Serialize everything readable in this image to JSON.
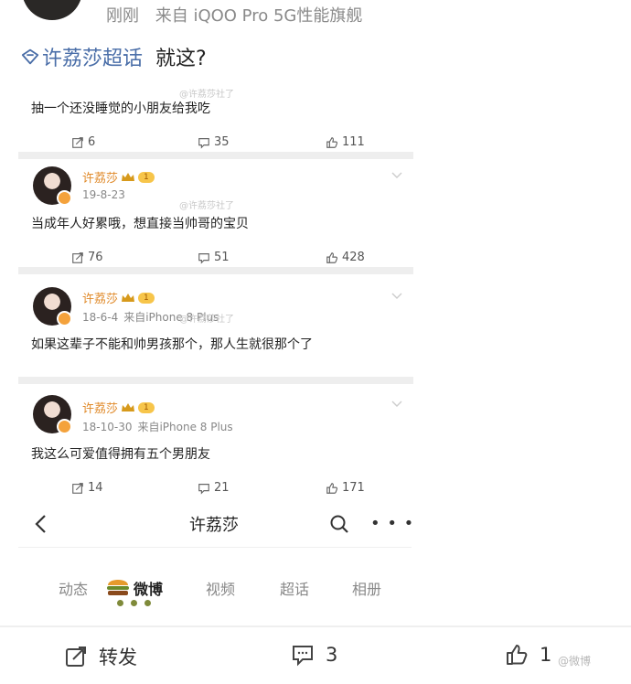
{
  "header": {
    "time": "刚刚",
    "source": "来自 iQOO Pro 5G性能旗舰"
  },
  "topic": {
    "name": "许荔莎超话",
    "text": "就这?"
  },
  "posts": [
    {
      "text": "抽一个还没睡觉的小朋友给我吃",
      "reposts": "6",
      "comments": "35",
      "likes": "111",
      "watermark": "@许荔莎社了"
    },
    {
      "user": "许荔莎",
      "level": "1",
      "date": "19-8-23",
      "text": "当成年人好累哦，想直接当帅哥的宝贝",
      "reposts": "76",
      "comments": "51",
      "likes": "428",
      "watermark": "@许荔莎社了"
    },
    {
      "user": "许荔莎",
      "level": "1",
      "date": "18-6-4",
      "source": "来自iPhone 8 Plus",
      "text": "如果这辈子不能和帅男孩那个，那人生就很那个了",
      "watermark": "@许荔莎社了"
    },
    {
      "user": "许荔莎",
      "level": "1",
      "date": "18-10-30",
      "source": "来自iPhone 8 Plus",
      "text": "我这么可爱值得拥有五个男朋友",
      "reposts": "14",
      "comments": "21",
      "likes": "171"
    }
  ],
  "profile_nav": {
    "title": "许荔莎",
    "back_icon": "chevron-left-icon",
    "search_icon": "search-icon",
    "more_icon": "more-icon",
    "tabs": [
      "动态",
      "微博",
      "视频",
      "超话",
      "相册"
    ],
    "active_tab": "微博"
  },
  "footer": {
    "repost_label": "转发",
    "comment_count": "3",
    "like_count": "1",
    "watermark": "@微博"
  },
  "colors": {
    "topic_link": "#4a6ea8",
    "username": "#e08a2a",
    "meta_gray": "#8a8a8a"
  }
}
